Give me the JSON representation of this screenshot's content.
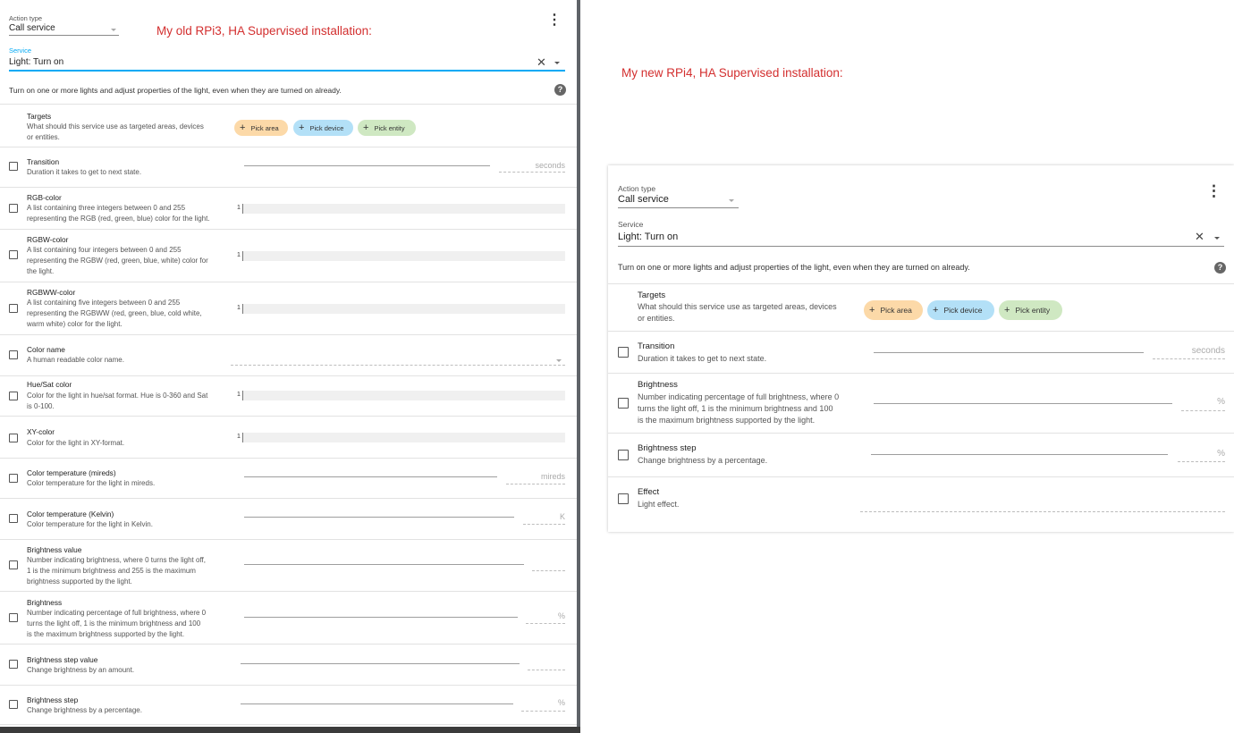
{
  "captions": {
    "old": "My old RPi3, HA Supervised installation:",
    "new": "My new RPi4, HA Supervised installation:"
  },
  "left": {
    "action_type_label": "Action type",
    "action_type_value": "Call service",
    "service_label": "Service",
    "service_value": "Light: Turn on",
    "description": "Turn on one or more lights and adjust properties of the light, even when they are turned on already.",
    "targets": {
      "title": "Targets",
      "desc": [
        "What should this service use as targeted areas, devices",
        "or entities."
      ],
      "chips": {
        "area": "Pick area",
        "device": "Pick device",
        "entity": "Pick entity"
      }
    },
    "rows": [
      {
        "title": "Transition",
        "desc": [
          "Duration it takes to get to next state."
        ],
        "unit": "seconds"
      },
      {
        "title": "RGB-color",
        "desc": [
          "A list containing three integers between 0 and 255",
          "representing the RGB (red, green, blue) color for the light."
        ],
        "value": "1"
      },
      {
        "title": "RGBW-color",
        "desc": [
          "A list containing four integers between 0 and 255",
          "representing the RGBW (red, green, blue, white) color for",
          "the light."
        ],
        "value": "1"
      },
      {
        "title": "RGBWW-color",
        "desc": [
          "A list containing five integers between 0 and 255",
          "representing the RGBWW (red, green, blue, cold white,",
          "warm white) color for the light."
        ],
        "value": "1"
      },
      {
        "title": "Color name",
        "desc": [
          "A human readable color name."
        ]
      },
      {
        "title": "Hue/Sat color",
        "desc": [
          "Color for the light in hue/sat format. Hue is 0-360 and Sat",
          "is 0-100."
        ],
        "value": "1"
      },
      {
        "title": "XY-color",
        "desc": [
          "Color for the light in XY-format."
        ],
        "value": "1"
      },
      {
        "title": "Color temperature (mireds)",
        "desc": [
          "Color temperature for the light in mireds."
        ],
        "unit": "mireds"
      },
      {
        "title": "Color temperature (Kelvin)",
        "desc": [
          "Color temperature for the light in Kelvin."
        ],
        "unit": "K"
      },
      {
        "title": "Brightness value",
        "desc": [
          "Number indicating brightness, where 0 turns the light off,",
          "1 is the minimum brightness and 255 is the maximum",
          "brightness supported by the light."
        ]
      },
      {
        "title": "Brightness",
        "desc": [
          "Number indicating percentage of full brightness, where 0",
          "turns the light off, 1 is the minimum brightness and 100",
          "is the maximum brightness supported by the light."
        ],
        "unit": "%"
      },
      {
        "title": "Brightness step value",
        "desc": [
          "Change brightness by an amount."
        ]
      },
      {
        "title": "Brightness step",
        "desc": [
          "Change brightness by a percentage."
        ],
        "unit": "%"
      }
    ]
  },
  "right": {
    "action_type_label": "Action type",
    "action_type_value": "Call service",
    "service_label": "Service",
    "service_value": "Light: Turn on",
    "description": "Turn on one or more lights and adjust properties of the light, even when they are turned on already.",
    "targets": {
      "title": "Targets",
      "desc": [
        "What should this service use as targeted areas, devices",
        "or entities."
      ],
      "chips": {
        "area": "Pick area",
        "device": "Pick device",
        "entity": "Pick entity"
      }
    },
    "rows": [
      {
        "title": "Transition",
        "desc": [
          "Duration it takes to get to next state."
        ],
        "unit": "seconds"
      },
      {
        "title": "Brightness",
        "desc": [
          "Number indicating percentage of full brightness, where 0",
          "turns the light off, 1 is the minimum brightness and 100",
          "is the maximum brightness supported by the light."
        ],
        "unit": "%"
      },
      {
        "title": "Brightness step",
        "desc": [
          "Change brightness by a percentage."
        ],
        "unit": "%"
      },
      {
        "title": "Effect",
        "desc": [
          "Light effect."
        ]
      }
    ]
  },
  "icons": {
    "menu": "more-vert-icon",
    "clear": "close-icon",
    "dropdown": "chevron-down-icon",
    "help": "help-circle-icon",
    "plus": "plus-icon"
  },
  "glyphs": {
    "kebab": "⋮",
    "clear": "✕",
    "help": "?",
    "plus": "+"
  },
  "colors": {
    "caption": "#d32f2f",
    "chip_area": "#fcd9a8",
    "chip_device": "#b3e0f7",
    "chip_entity": "#cfe8c2"
  }
}
